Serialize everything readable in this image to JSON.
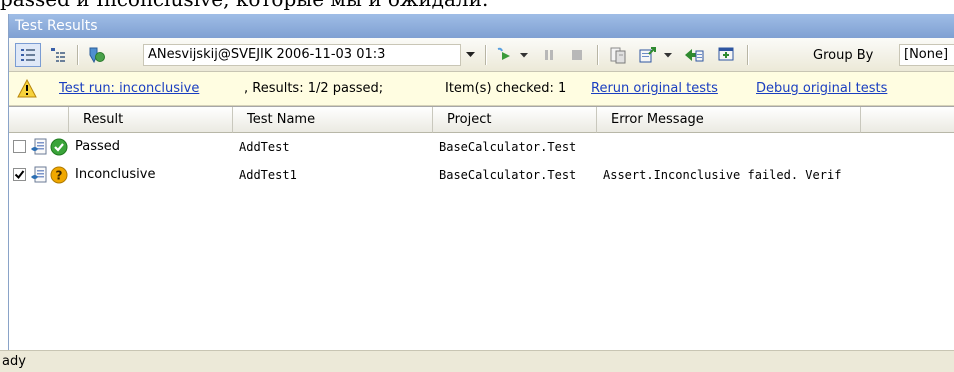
{
  "top_text": "passed и Inconclusive, которые мы и ожидали.",
  "window": {
    "title": "Test Results"
  },
  "toolbar": {
    "run_selector": "ANesvijskij@SVEJIK 2006-11-03 01:3",
    "group_by_label": "Group By",
    "group_by_value": "[None]",
    "icons": [
      "view-list-icon",
      "view-details-icon",
      "test-run-icon",
      "run-tests-icon",
      "pause-icon",
      "stop-icon",
      "import-icon",
      "export-icon",
      "publish-icon",
      "select-columns-icon"
    ]
  },
  "info_bar": {
    "run_link": "Test run: inconclusive",
    "results_text": ", Results: 1/2 passed;",
    "checked_text": "Item(s) checked: 1",
    "rerun_link": "Rerun original tests",
    "debug_link": "Debug original tests"
  },
  "grid": {
    "columns": [
      "Result",
      "Test Name",
      "Project",
      "Error Message"
    ],
    "rows": [
      {
        "checked": false,
        "result": "Passed",
        "test_name": "AddTest",
        "project": "BaseCalculator.Test",
        "error": "",
        "status_icon": "pass-icon"
      },
      {
        "checked": true,
        "result": "Inconclusive",
        "test_name": "AddTest1",
        "project": "BaseCalculator.Test",
        "error": "Assert.Inconclusive failed. Verif",
        "status_icon": "inconclusive-icon"
      }
    ]
  },
  "status_bar": {
    "text": "ady"
  },
  "colors": {
    "title_bar": "#8eaedc",
    "info_bar": "#fffde1",
    "link": "#1a3ec0",
    "pass": "#3aa43a",
    "inconclusive": "#f0a800"
  }
}
